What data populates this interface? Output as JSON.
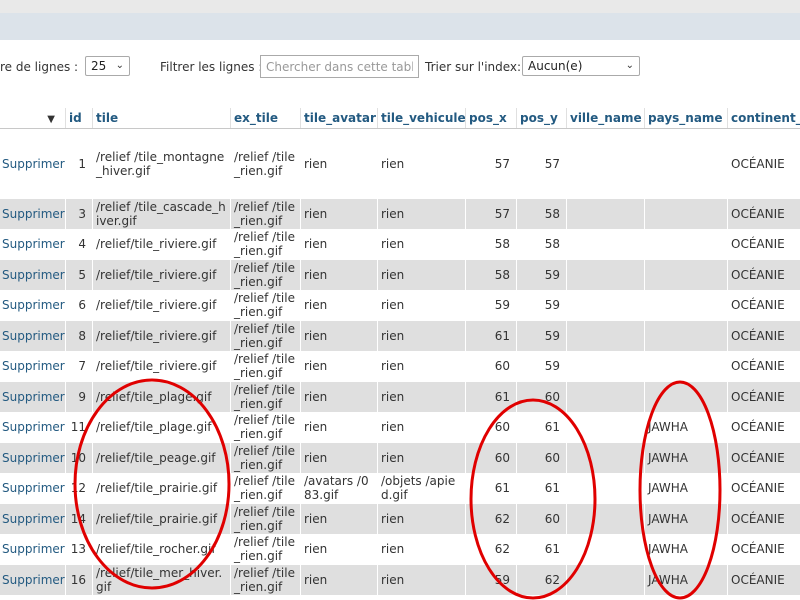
{
  "controls": {
    "rows_label": "re de lignes :",
    "rows_value": "25",
    "filter_label": "Filtrer les lignes :",
    "filter_placeholder": "Chercher dans cette table",
    "sort_label": "Trier sur l'index:",
    "sort_value": "Aucun(e)"
  },
  "columns": [
    "id",
    "tile",
    "ex_tile",
    "tile_avatar",
    "tile_vehicule",
    "pos_x",
    "pos_y",
    "ville_name",
    "pays_name",
    "continent_na"
  ],
  "action_label": "Supprimer",
  "rows": [
    {
      "id": "1",
      "tile": "/relief /tile_montagne_hiver.gif",
      "ex_tile": "/relief /tile_rien.gif",
      "avatar": "rien",
      "vehicule": "rien",
      "pos_x": "57",
      "pos_y": "57",
      "ville": "",
      "pays": "",
      "continent": "OCÉANIE"
    },
    {
      "id": "3",
      "tile": "/relief /tile_cascade_hiver.gif",
      "ex_tile": "/relief /tile_rien.gif",
      "avatar": "rien",
      "vehicule": "rien",
      "pos_x": "57",
      "pos_y": "58",
      "ville": "",
      "pays": "",
      "continent": "OCÉANIE"
    },
    {
      "id": "4",
      "tile": "/relief/tile_riviere.gif",
      "ex_tile": "/relief /tile_rien.gif",
      "avatar": "rien",
      "vehicule": "rien",
      "pos_x": "58",
      "pos_y": "58",
      "ville": "",
      "pays": "",
      "continent": "OCÉANIE"
    },
    {
      "id": "5",
      "tile": "/relief/tile_riviere.gif",
      "ex_tile": "/relief /tile_rien.gif",
      "avatar": "rien",
      "vehicule": "rien",
      "pos_x": "58",
      "pos_y": "59",
      "ville": "",
      "pays": "",
      "continent": "OCÉANIE"
    },
    {
      "id": "6",
      "tile": "/relief/tile_riviere.gif",
      "ex_tile": "/relief /tile_rien.gif",
      "avatar": "rien",
      "vehicule": "rien",
      "pos_x": "59",
      "pos_y": "59",
      "ville": "",
      "pays": "",
      "continent": "OCÉANIE"
    },
    {
      "id": "8",
      "tile": "/relief/tile_riviere.gif",
      "ex_tile": "/relief /tile_rien.gif",
      "avatar": "rien",
      "vehicule": "rien",
      "pos_x": "61",
      "pos_y": "59",
      "ville": "",
      "pays": "",
      "continent": "OCÉANIE"
    },
    {
      "id": "7",
      "tile": "/relief/tile_riviere.gif",
      "ex_tile": "/relief /tile_rien.gif",
      "avatar": "rien",
      "vehicule": "rien",
      "pos_x": "60",
      "pos_y": "59",
      "ville": "",
      "pays": "",
      "continent": "OCÉANIE"
    },
    {
      "id": "9",
      "tile": "/relief/tile_plage.gif",
      "ex_tile": "/relief /tile_rien.gif",
      "avatar": "rien",
      "vehicule": "rien",
      "pos_x": "61",
      "pos_y": "60",
      "ville": "",
      "pays": "",
      "continent": "OCÉANIE"
    },
    {
      "id": "11",
      "tile": "/relief/tile_plage.gif",
      "ex_tile": "/relief /tile_rien.gif",
      "avatar": "rien",
      "vehicule": "rien",
      "pos_x": "60",
      "pos_y": "61",
      "ville": "",
      "pays": "JAWHA",
      "continent": "OCÉANIE"
    },
    {
      "id": "10",
      "tile": "/relief/tile_peage.gif",
      "ex_tile": "/relief /tile_rien.gif",
      "avatar": "rien",
      "vehicule": "rien",
      "pos_x": "60",
      "pos_y": "60",
      "ville": "",
      "pays": "JAWHA",
      "continent": "OCÉANIE"
    },
    {
      "id": "12",
      "tile": "/relief/tile_prairie.gif",
      "ex_tile": "/relief /tile_rien.gif",
      "avatar": "/avatars /083.gif",
      "vehicule": "/objets /apied.gif",
      "pos_x": "61",
      "pos_y": "61",
      "ville": "",
      "pays": "JAWHA",
      "continent": "OCÉANIE"
    },
    {
      "id": "14",
      "tile": "/relief/tile_prairie.gif",
      "ex_tile": "/relief /tile_rien.gif",
      "avatar": "rien",
      "vehicule": "rien",
      "pos_x": "62",
      "pos_y": "60",
      "ville": "",
      "pays": "JAWHA",
      "continent": "OCÉANIE"
    },
    {
      "id": "13",
      "tile": "/relief/tile_rocher.gif",
      "ex_tile": "/relief /tile_rien.gif",
      "avatar": "rien",
      "vehicule": "rien",
      "pos_x": "62",
      "pos_y": "61",
      "ville": "",
      "pays": "JAWHA",
      "continent": "OCÉANIE"
    },
    {
      "id": "16",
      "tile": "/relief/tile_mer_hiver.gif",
      "ex_tile": "/relief /tile_rien.gif",
      "avatar": "rien",
      "vehicule": "rien",
      "pos_x": "59",
      "pos_y": "62",
      "ville": "",
      "pays": "JAWHA",
      "continent": "OCÉANIE"
    },
    {
      "id": "",
      "tile": "",
      "ex_tile": "/relief",
      "avatar": "",
      "vehicule": "",
      "pos_x": "",
      "pos_y": "",
      "ville": "",
      "pays": "",
      "continent": ""
    }
  ],
  "colors": {
    "link": "#235a81",
    "row_alt": "#dfdfdf",
    "header_strip": "#dce3ea",
    "annotation": "#e00000"
  }
}
